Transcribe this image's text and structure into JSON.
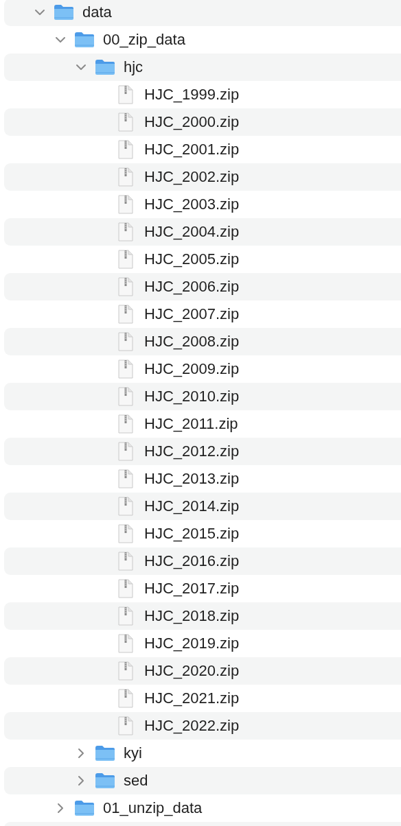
{
  "tree": [
    {
      "kind": "folder",
      "name": "data",
      "expanded": true,
      "children": [
        {
          "kind": "folder",
          "name": "00_zip_data",
          "expanded": true,
          "children": [
            {
              "kind": "folder",
              "name": "hjc",
              "expanded": true,
              "children": [
                {
                  "kind": "zip",
                  "name": "HJC_1999.zip"
                },
                {
                  "kind": "zip",
                  "name": "HJC_2000.zip"
                },
                {
                  "kind": "zip",
                  "name": "HJC_2001.zip"
                },
                {
                  "kind": "zip",
                  "name": "HJC_2002.zip"
                },
                {
                  "kind": "zip",
                  "name": "HJC_2003.zip"
                },
                {
                  "kind": "zip",
                  "name": "HJC_2004.zip"
                },
                {
                  "kind": "zip",
                  "name": "HJC_2005.zip"
                },
                {
                  "kind": "zip",
                  "name": "HJC_2006.zip"
                },
                {
                  "kind": "zip",
                  "name": "HJC_2007.zip"
                },
                {
                  "kind": "zip",
                  "name": "HJC_2008.zip"
                },
                {
                  "kind": "zip",
                  "name": "HJC_2009.zip"
                },
                {
                  "kind": "zip",
                  "name": "HJC_2010.zip"
                },
                {
                  "kind": "zip",
                  "name": "HJC_2011.zip"
                },
                {
                  "kind": "zip",
                  "name": "HJC_2012.zip"
                },
                {
                  "kind": "zip",
                  "name": "HJC_2013.zip"
                },
                {
                  "kind": "zip",
                  "name": "HJC_2014.zip"
                },
                {
                  "kind": "zip",
                  "name": "HJC_2015.zip"
                },
                {
                  "kind": "zip",
                  "name": "HJC_2016.zip"
                },
                {
                  "kind": "zip",
                  "name": "HJC_2017.zip"
                },
                {
                  "kind": "zip",
                  "name": "HJC_2018.zip"
                },
                {
                  "kind": "zip",
                  "name": "HJC_2019.zip"
                },
                {
                  "kind": "zip",
                  "name": "HJC_2020.zip"
                },
                {
                  "kind": "zip",
                  "name": "HJC_2021.zip"
                },
                {
                  "kind": "zip",
                  "name": "HJC_2022.zip"
                }
              ]
            },
            {
              "kind": "folder",
              "name": "kyi",
              "expanded": false
            },
            {
              "kind": "folder",
              "name": "sed",
              "expanded": false
            }
          ]
        },
        {
          "kind": "folder",
          "name": "01_unzip_data",
          "expanded": false
        }
      ]
    }
  ]
}
